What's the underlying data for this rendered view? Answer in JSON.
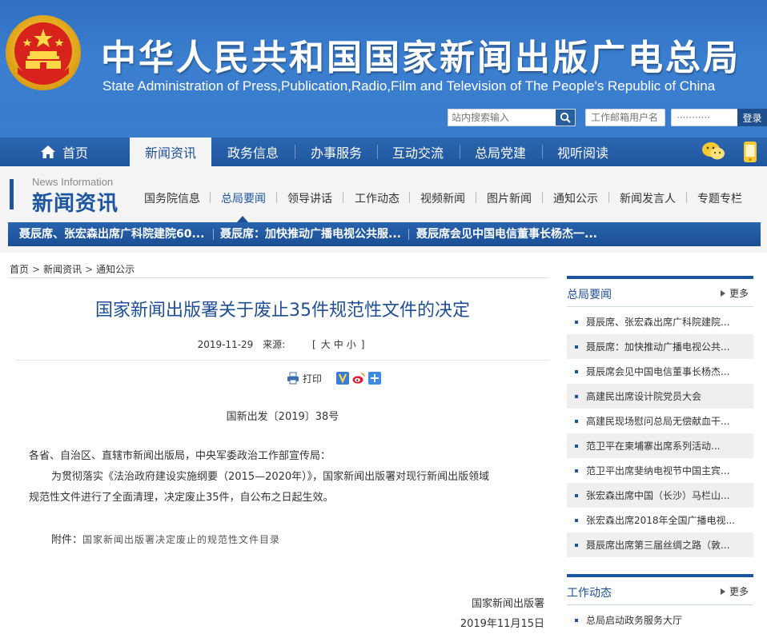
{
  "header": {
    "title_cn": "中华人民共和国国家新闻出版广电总局",
    "title_en": "State Administration of Press,Publication,Radio,Film and Television of The People's Republic of China",
    "search_placeholder": "站内搜索输入",
    "mail_user_placeholder": "工作邮箱用户名",
    "mail_pass_placeholder": "···········",
    "login_label": "登录"
  },
  "mainnav": {
    "items": [
      {
        "label": "首页"
      },
      {
        "label": "新闻资讯"
      },
      {
        "label": "政务信息"
      },
      {
        "label": "办事服务"
      },
      {
        "label": "互动交流"
      },
      {
        "label": "总局党建"
      },
      {
        "label": "视听阅读"
      }
    ]
  },
  "section": {
    "en": "News Information",
    "cn": "新闻资讯"
  },
  "subnav": {
    "items": [
      {
        "label": "国务院信息"
      },
      {
        "label": "总局要闻"
      },
      {
        "label": "领导讲话"
      },
      {
        "label": "工作动态"
      },
      {
        "label": "视频新闻"
      },
      {
        "label": "图片新闻"
      },
      {
        "label": "通知公示"
      },
      {
        "label": "新闻发言人"
      },
      {
        "label": "专题专栏"
      }
    ]
  },
  "ticker": [
    "聂辰席、张宏森出席广科院建院60...",
    "聂辰席：加快推动广播电视公共服...",
    "聂辰席会见中国电信董事长杨杰一..."
  ],
  "breadcrumb": [
    "首页",
    "新闻资讯",
    "通知公示"
  ],
  "article": {
    "title": "国家新闻出版署关于废止35件规范性文件的决定",
    "date": "2019-11-29",
    "source_label": "来源:",
    "font_size_open": "[",
    "font_large": "大",
    "font_medium": "中",
    "font_small": "小",
    "font_size_close": "]",
    "print_label": "打印",
    "doc_number": "国新出发〔2019〕38号",
    "addressee": "各省、自治区、直辖市新闻出版局，中央军委政治工作部宣传局：",
    "body_line1": "为贯彻落实《法治政府建设实施纲要（2015—2020年）》，国家新闻出版署对现行新闻出版领域",
    "body_line2": "规范性文件进行了全面清理，决定废止35件，自公布之日起生效。",
    "attachment_label": "附件：",
    "attachment_link": "国家新闻出版署决定废止的规范性文件目录",
    "signature_org": "国家新闻出版署",
    "signature_date": "2019年11月15日"
  },
  "sidebar": {
    "box1": {
      "title": "总局要闻",
      "more": "更多",
      "items": [
        "聂辰席、张宏森出席广科院建院...",
        "聂辰席：加快推动广播电视公共...",
        "聂辰席会见中国电信董事长杨杰...",
        "高建民出席设计院党员大会",
        "高建民现场慰问总局无偿献血干...",
        "范卫平在柬埔寨出席系列活动...",
        "范卫平出席斐纳电视节中国主宾...",
        "张宏森出席中国（长沙）马栏山...",
        "张宏森出席2018年全国广播电视...",
        "聂辰席出席第三届丝绸之路（敦..."
      ]
    },
    "box2": {
      "title": "工作动态",
      "more": "更多",
      "items": [
        "总局启动政务服务大厅"
      ]
    }
  }
}
